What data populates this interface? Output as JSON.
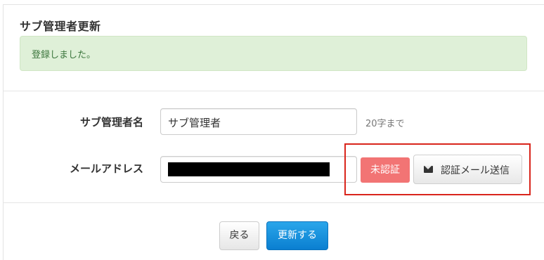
{
  "page": {
    "title": "サブ管理者更新",
    "alert_message": "登録しました。"
  },
  "form": {
    "name_label": "サブ管理者名",
    "name_value": "サブ管理者",
    "name_hint": "20字まで",
    "email_label": "メールアドレス",
    "email_status": "未認証",
    "send_verification_label": "認証メール送信"
  },
  "actions": {
    "back_label": "戻る",
    "update_label": "更新する"
  },
  "colors": {
    "alert_bg": "#dff0d8",
    "alert_text": "#3c763d",
    "status_badge": "#f27474",
    "primary_button": "#1790dc",
    "highlight_box": "#d9251c"
  },
  "icons": {
    "send_verification": "envelope-icon"
  }
}
